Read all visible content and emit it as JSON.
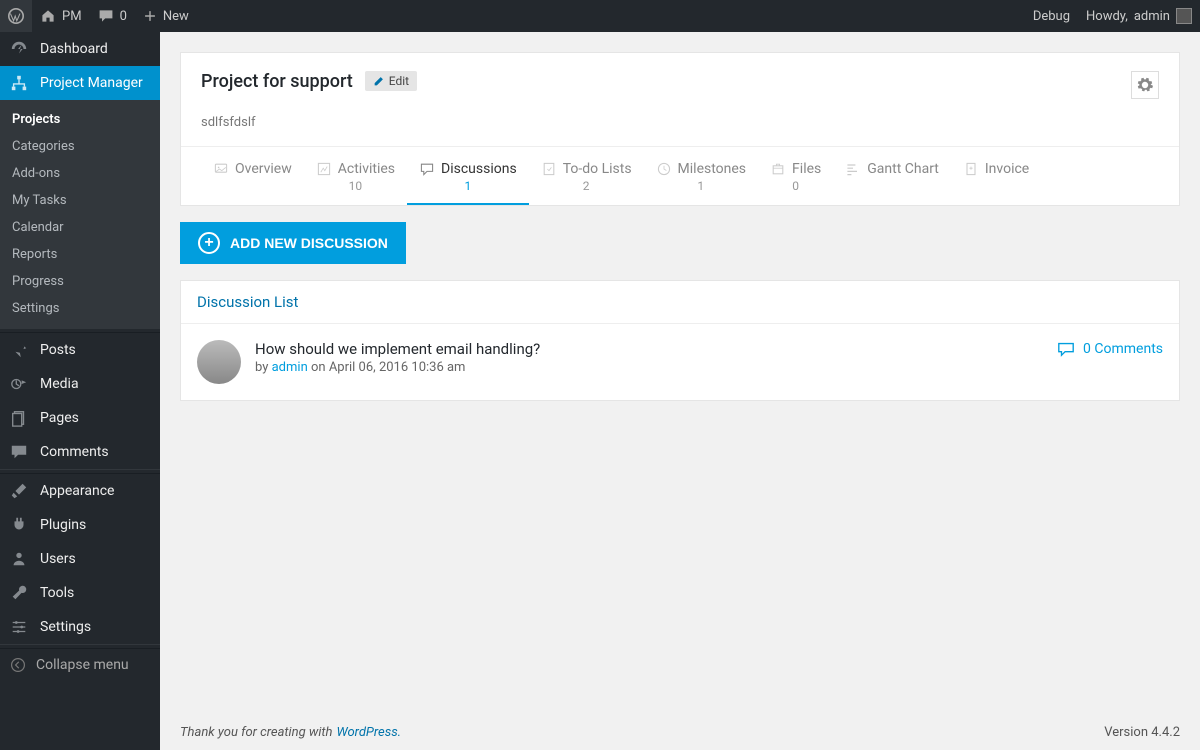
{
  "adminbar": {
    "site_label": "PM",
    "comments_count": "0",
    "new_label": "New",
    "debug_label": "Debug",
    "howdy_prefix": "Howdy, ",
    "howdy_user": "admin"
  },
  "sidebar": {
    "dashboard": "Dashboard",
    "project_manager": "Project Manager",
    "submenu": [
      "Projects",
      "Categories",
      "Add-ons",
      "My Tasks",
      "Calendar",
      "Reports",
      "Progress",
      "Settings"
    ],
    "submenu_current_index": 0,
    "posts": "Posts",
    "media": "Media",
    "pages": "Pages",
    "comments": "Comments",
    "appearance": "Appearance",
    "plugins": "Plugins",
    "users": "Users",
    "tools": "Tools",
    "settings": "Settings",
    "collapse": "Collapse menu"
  },
  "project": {
    "title": "Project for support",
    "edit_label": "Edit",
    "description": "sdlfsfdslf"
  },
  "tabs": [
    {
      "label": "Overview",
      "count": ""
    },
    {
      "label": "Activities",
      "count": "10"
    },
    {
      "label": "Discussions",
      "count": "1"
    },
    {
      "label": "To-do Lists",
      "count": "2"
    },
    {
      "label": "Milestones",
      "count": "1"
    },
    {
      "label": "Files",
      "count": "0"
    },
    {
      "label": "Gantt Chart",
      "count": ""
    },
    {
      "label": "Invoice",
      "count": ""
    }
  ],
  "active_tab_index": 2,
  "add_button": "ADD NEW DISCUSSION",
  "discussion_list": {
    "heading": "Discussion List",
    "items": [
      {
        "title": "How should we implement email handling?",
        "by_prefix": "by ",
        "author": "admin",
        "on_prefix": " on ",
        "date": "April 06, 2016 10:36 am",
        "comments_label": "0 Comments"
      }
    ]
  },
  "footer": {
    "thank_prefix": "Thank you for creating with ",
    "wp": "WordPress.",
    "version": "Version 4.4.2"
  }
}
